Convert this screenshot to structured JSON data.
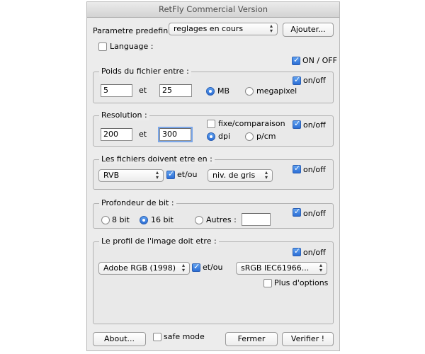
{
  "window": {
    "title": "RetFly Commercial Version"
  },
  "preset": {
    "label": "Parametre predefini",
    "selected": "reglages en cours",
    "add_button": "Ajouter..."
  },
  "language": {
    "label": "Language :",
    "checked": false
  },
  "master": {
    "label": "ON / OFF",
    "checked": true
  },
  "weight": {
    "title": "Poids du fichier entre :",
    "onoff": "on/off",
    "min": "5",
    "and": "et",
    "max": "25",
    "unit_mb": "MB",
    "unit_mp": "megapixel",
    "selected": "MB"
  },
  "resolution": {
    "title": "Resolution :",
    "fixed_label": "fixe/comparaison",
    "onoff": "on/off",
    "min": "200",
    "and": "et",
    "max": "300",
    "unit_dpi": "dpi",
    "unit_pcm": "p/cm",
    "selected": "dpi"
  },
  "files": {
    "title": "Les fichiers doivent etre en :",
    "mode1": "RVB",
    "andor": "et/ou",
    "mode2": "niv. de gris",
    "onoff": "on/off"
  },
  "bitdepth": {
    "title": "Profondeur de bit :",
    "opt8": "8 bit",
    "opt16": "16 bit",
    "other": "Autres :",
    "other_value": "",
    "selected": "16 bit",
    "onoff": "on/off"
  },
  "profile": {
    "title": "Le profil de l'image doit etre :",
    "onoff": "on/off",
    "profile1": "Adobe RGB (1998)",
    "andor": "et/ou",
    "profile2": "sRGB IEC61966...",
    "more_options": "Plus d'options"
  },
  "footer": {
    "about": "About...",
    "safe_mode": "safe mode",
    "close": "Fermer",
    "verify": "Verifier !"
  }
}
